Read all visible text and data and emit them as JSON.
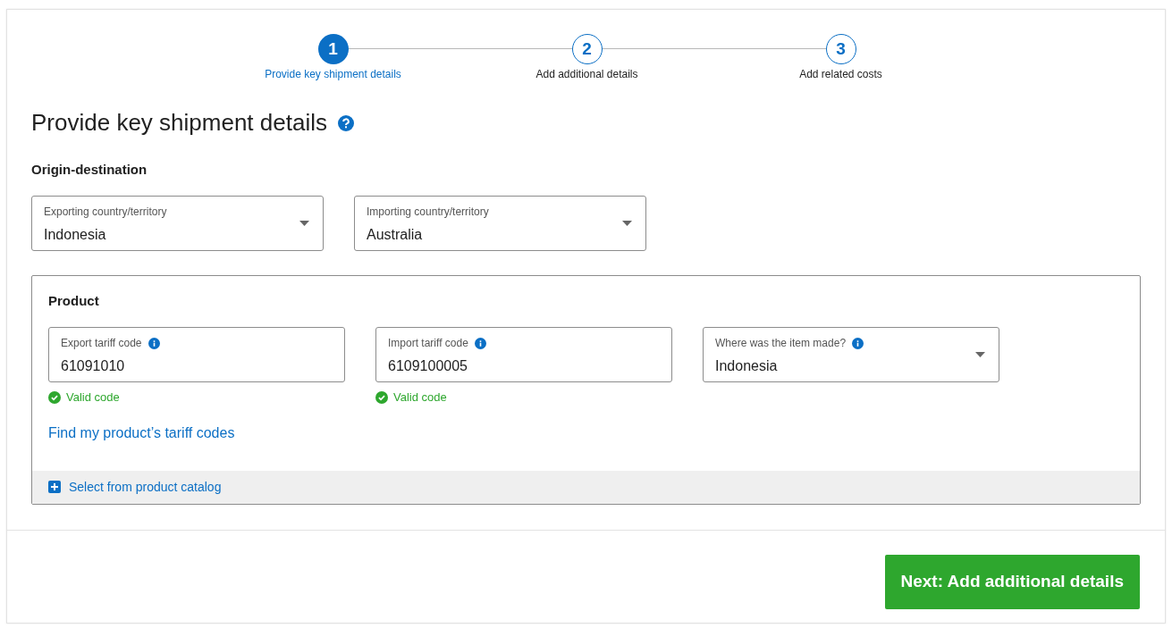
{
  "stepper": [
    {
      "number": "1",
      "label": "Provide key shipment details",
      "selected": true
    },
    {
      "number": "2",
      "label": "Add additional details",
      "selected": false
    },
    {
      "number": "3",
      "label": "Add related costs",
      "selected": false
    }
  ],
  "heading": "Provide key shipment details",
  "origin_destination": {
    "title": "Origin-destination",
    "fields": [
      {
        "kind": "select",
        "label": "Exporting country/territory",
        "value": "Indonesia"
      },
      {
        "kind": "select",
        "label": "Importing country/territory",
        "value": "Australia"
      }
    ]
  },
  "product": {
    "title": "Product",
    "fields": [
      {
        "kind": "text",
        "label": "Export tariff code",
        "value": "61091010",
        "info": true,
        "validation": "Valid code"
      },
      {
        "kind": "text",
        "label": "Import tariff code",
        "value": "6109100005",
        "info": true,
        "validation": "Valid code"
      },
      {
        "kind": "select",
        "label": "Where was the item made?",
        "value": "Indonesia",
        "info": true
      }
    ],
    "link": "Find my product’s tariff codes",
    "catalog": "Select from product catalog"
  },
  "next_button": "Next: Add additional details"
}
